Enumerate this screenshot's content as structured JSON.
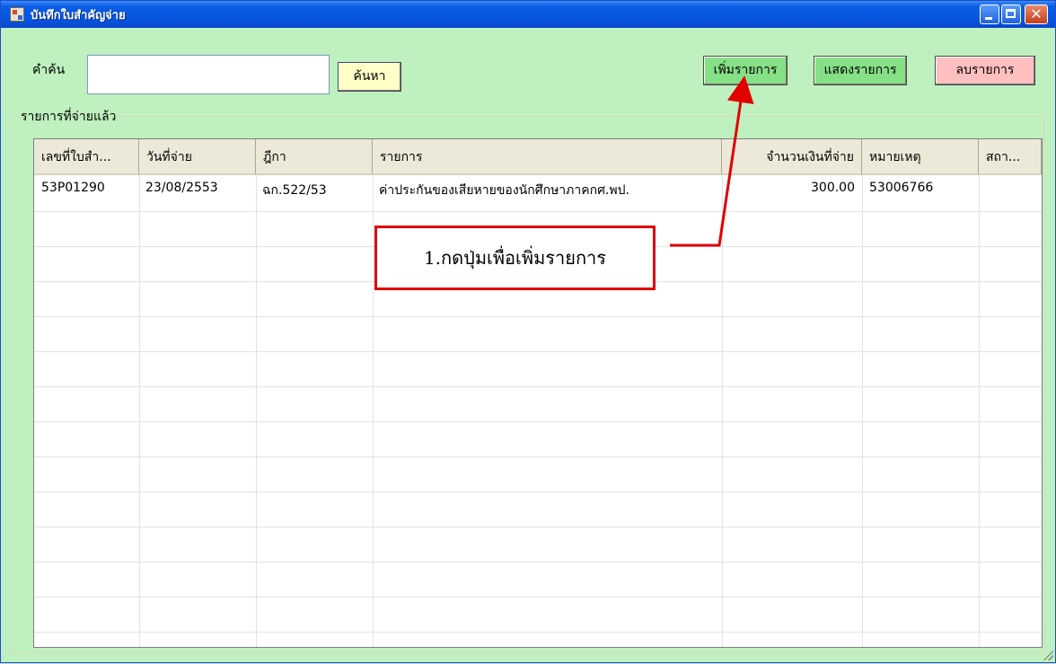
{
  "window": {
    "title": "บันทึกใบสำคัญจ่าย",
    "close_glyph": "✕"
  },
  "search": {
    "label": "คำค้น",
    "value": "",
    "button_label": "ค้นหา"
  },
  "toolbar": {
    "add_label": "เพิ่มรายการ",
    "show_label": "แสดงรายการ",
    "delete_label": "ลบรายการ"
  },
  "group": {
    "legend": "รายการที่จ่ายแล้ว"
  },
  "table": {
    "headers": [
      "เลขที่ใบสำ...",
      "วันที่จ่าย",
      "ฎีกา",
      "รายการ",
      "จำนวนเงินที่จ่าย",
      "หมายเหตุ",
      "สถา..."
    ],
    "rows": [
      [
        "53P01290",
        "23/08/2553",
        "ฉก.522/53",
        "ค่าประกันของเสียหายของนักศึกษาภาคกศ.พป.",
        "300.00",
        "53006766",
        ""
      ]
    ]
  },
  "annotation": {
    "text": "1.กดปุ่มเพื่อเพิ่มรายการ",
    "color": "#e00000"
  },
  "colors": {
    "window_bg": "#bff0bf",
    "add_button": "#86e086",
    "delete_button": "#ffbfbf",
    "search_button": "#ffffc8"
  }
}
